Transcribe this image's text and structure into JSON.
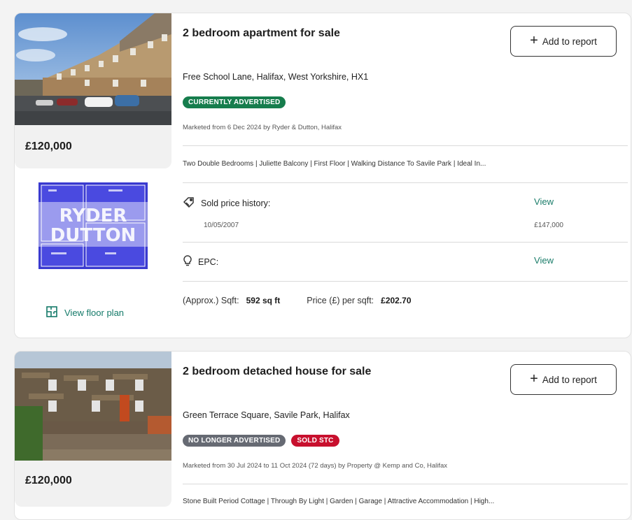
{
  "listings": [
    {
      "price": "£120,000",
      "title": "2 bedroom apartment for sale",
      "add_to_report": "Add to report",
      "address": "Free School Lane, Halifax, West Yorkshire, HX1",
      "badges": [
        {
          "label": "CURRENTLY ADVERTISED",
          "color": "#167d4d"
        }
      ],
      "marketed": "Marketed from 6 Dec 2024 by Ryder & Dutton, Halifax",
      "features": "Two Double Bedrooms | Juliette Balcony | First Floor | Walking Distance To Savile Park | Ideal In...",
      "sold_history_label": "Sold price history:",
      "sold_history_view": "View",
      "sold_history_date": "10/05/2007",
      "sold_history_price": "£147,000",
      "epc_label": "EPC:",
      "epc_view": "View",
      "sqft_label": "(Approx.) Sqft:",
      "sqft_value": "592 sq ft",
      "ppsf_label": "Price (£) per sqft:",
      "ppsf_value": "£202.70",
      "floor_plan_link": "View floor plan",
      "floor_plan_watermark": [
        "RYDER",
        "DUTTON"
      ]
    },
    {
      "price": "£120,000",
      "title": "2 bedroom detached house for sale",
      "add_to_report": "Add to report",
      "address": "Green Terrace Square, Savile Park, Halifax",
      "badges": [
        {
          "label": "NO LONGER ADVERTISED",
          "color": "#666a73"
        },
        {
          "label": "SOLD STC",
          "color": "#c8102e"
        }
      ],
      "marketed": "Marketed from 30 Jul 2024 to 11 Oct 2024 (72 days) by Property @ Kemp and Co, Halifax",
      "features": "Stone Built Period Cottage | Through By Light | Garden | Garage | Attractive Accommodation | High..."
    }
  ],
  "icons": {
    "add": "plus-icon",
    "sold_history": "tag-icon",
    "epc": "lightbulb-icon",
    "floor_plan": "floor-plan-icon"
  },
  "colors": {
    "accent_link": "#147a69",
    "badge_green": "#167d4d",
    "badge_grey": "#666a73",
    "badge_red": "#c8102e"
  }
}
